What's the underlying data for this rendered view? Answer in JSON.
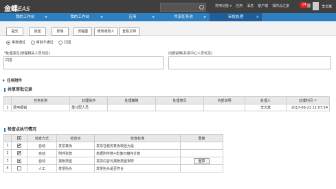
{
  "app": {
    "logo_main": "金蝶",
    "logo_sub": "EAS"
  },
  "topbar": {
    "links": [
      "常用功能 ▾",
      "应用",
      "消息",
      "客户端",
      "我的云之家"
    ],
    "badge": "14",
    "username": "李文斌"
  },
  "tabs": [
    {
      "label": "我的工作台"
    },
    {
      "label": "我的工作台"
    },
    {
      "label": "应用"
    },
    {
      "label": "共享任务池"
    },
    {
      "label": "审批处理"
    }
  ],
  "toolbar": [
    "提交",
    "驳回",
    "影像",
    "流程图",
    "修改收款人",
    "查看文档"
  ],
  "decision": {
    "options": [
      "审批通过",
      "审批不通过",
      "打回"
    ]
  },
  "opinion": {
    "label": "*处理意见(流程相关人员可见)",
    "value": "同意"
  },
  "internal": {
    "label": "内部说明(共享中心人员可见)",
    "value": ""
  },
  "attachments": {
    "label": "任务附件"
  },
  "records": {
    "title": "共享审批记录",
    "columns": [
      "任务名称",
      "处理操作",
      "处理策略",
      "处理意见",
      "内部说明",
      "处理人",
      "处理时间"
    ],
    "rows": [
      {
        "n": "1",
        "task": "费用报销",
        "op": "重分配人员",
        "strategy": "",
        "opinion": "",
        "note": "",
        "person": "李文斌",
        "time": "2017-06-21 11:07:54"
      }
    ]
  },
  "checks": {
    "title": "检查点执行情况",
    "columns": [
      "检查方式",
      "检查点",
      "检查标准",
      "重算"
    ],
    "rows": [
      {
        "n": "1",
        "mode": "自动",
        "point": "发票真伪",
        "standard": "发票在税务真伪校验为是",
        "recalc": ""
      },
      {
        "n": "2",
        "mode": "自动",
        "point": "附件张数",
        "standard": "单据附件数=影像扫描件计数",
        "recalc": ""
      },
      {
        "n": "3",
        "mode": "自动",
        "point": "报账类型",
        "standard": "发票内容与报账类型相符",
        "recalc": "重算"
      },
      {
        "n": "4",
        "mode": "人工",
        "point": "发票抬头",
        "standard": "发票抬头是否符合",
        "recalc": ""
      }
    ]
  }
}
